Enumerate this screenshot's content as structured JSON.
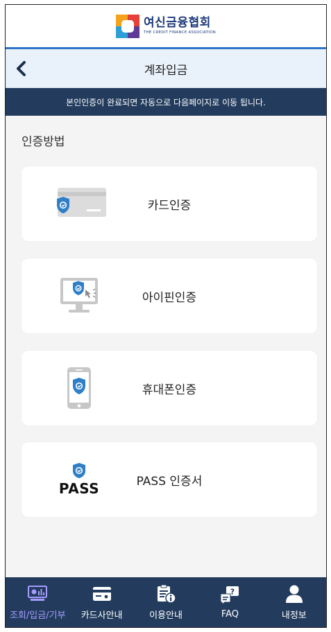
{
  "header": {
    "logo_name": "여신금융협회",
    "logo_subtitle": "THE CREDIT FINANCE ASSOCIATION"
  },
  "navbar": {
    "title": "계좌입금",
    "back_icon": "chevron-left-icon"
  },
  "notice": {
    "text": "본인인증이 완료되면 자동으로 다음페이지로 이동 됩니다."
  },
  "auth": {
    "section_title": "인증방법",
    "methods": [
      {
        "label": "카드인증",
        "icon": "card-shield-icon"
      },
      {
        "label": "아이핀인증",
        "icon": "monitor-shield-icon"
      },
      {
        "label": "휴대폰인증",
        "icon": "phone-shield-icon"
      },
      {
        "label": "PASS 인증서",
        "icon": "pass-logo-icon",
        "icon_text": "PASS"
      }
    ]
  },
  "tabs": [
    {
      "label": "조회/입금/기부",
      "icon": "chart-monitor-icon",
      "active": true
    },
    {
      "label": "카드사안내",
      "icon": "credit-card-icon",
      "active": false
    },
    {
      "label": "이용안내",
      "icon": "clipboard-info-icon",
      "active": false
    },
    {
      "label": "FAQ",
      "icon": "question-chat-icon",
      "active": false
    },
    {
      "label": "내정보",
      "icon": "user-icon",
      "active": false
    }
  ],
  "colors": {
    "accent_blue": "#2d73c4",
    "navy": "#233c5e",
    "shield_blue": "#2f7fc8",
    "active_tab": "#a79cff"
  }
}
